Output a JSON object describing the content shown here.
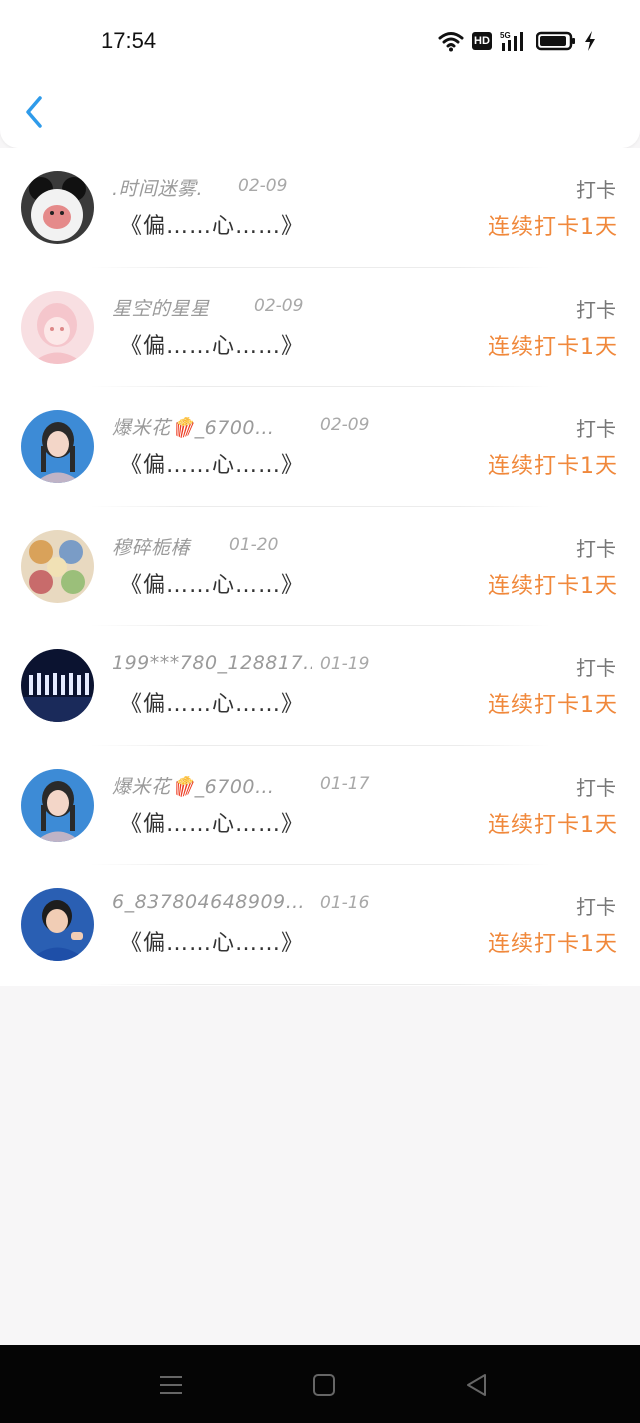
{
  "status_bar": {
    "time": "17:54",
    "hd_label": "HD",
    "net_label": "5G"
  },
  "colors": {
    "accent_orange": "#f0883b",
    "back_arrow": "#2f9bea"
  },
  "icons": {
    "back": "back-arrow-icon",
    "wifi": "wifi-icon",
    "signal": "signal-icon",
    "battery": "battery-icon",
    "charging": "charging-icon",
    "menu": "menu-icon",
    "home": "home-icon",
    "nav_back": "nav-back-icon"
  },
  "records": [
    {
      "name": ".时间迷雾.",
      "date": "02-09",
      "quote": "《偏……心……》",
      "action": "打卡",
      "streak": "连续打卡1天",
      "avatar": "panda-doll"
    },
    {
      "name": "星空的星星",
      "date": "02-09",
      "quote": "《偏……心……》",
      "action": "打卡",
      "streak": "连续打卡1天",
      "avatar": "pink-girl"
    },
    {
      "name": "爆米花🍿_6700…",
      "date": "02-09",
      "quote": "《偏……心……》",
      "action": "打卡",
      "streak": "连续打卡1天",
      "avatar": "girl-braids"
    },
    {
      "name": "穆碎栀椿",
      "date": "01-20",
      "quote": "《偏……心……》",
      "action": "打卡",
      "streak": "连续打卡1天",
      "avatar": "cartoon-stickers"
    },
    {
      "name": "199***780_128817…",
      "date": "01-19",
      "quote": "《偏……心……》",
      "action": "打卡",
      "streak": "连续打卡1天",
      "avatar": "stage-group"
    },
    {
      "name": "爆米花🍿_6700…",
      "date": "01-17",
      "quote": "《偏……心……》",
      "action": "打卡",
      "streak": "连续打卡1天",
      "avatar": "girl-braids"
    },
    {
      "name": "6_837804648909…",
      "date": "01-16",
      "quote": "《偏……心……》",
      "action": "打卡",
      "streak": "连续打卡1天",
      "avatar": "boy-blue"
    }
  ]
}
